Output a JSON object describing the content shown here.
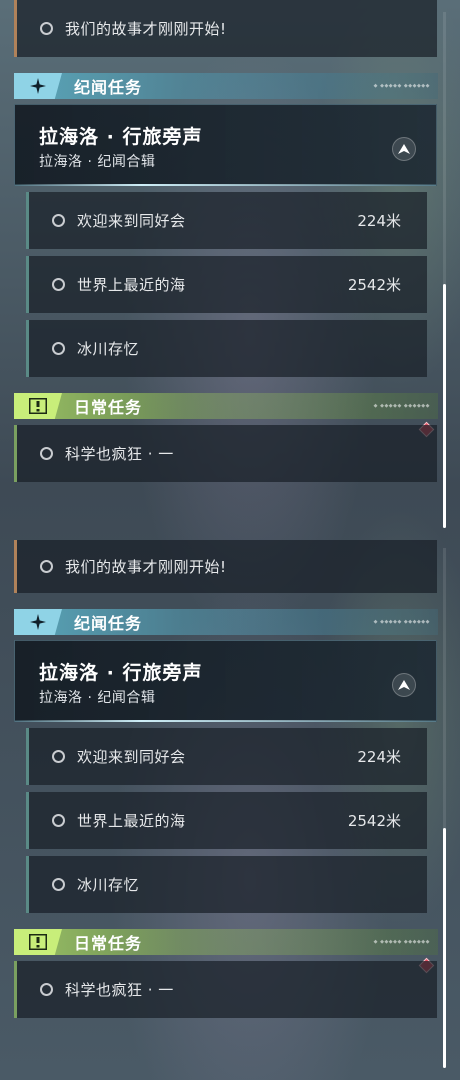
{
  "colors": {
    "explore_accent": "#8fd3e6",
    "daily_accent": "#c8ee7a",
    "notify": "#e04b5d"
  },
  "panels": [
    {
      "story_task": {
        "label": "我们的故事才刚刚开始!"
      },
      "explore_header": {
        "title": "纪闻任务",
        "icon": "sparkle-icon"
      },
      "quest": {
        "title": "拉海洛 · 行旅旁声",
        "subtitle": "拉海洛 · 纪闻合辑",
        "button_icon": "navigate-arrow-icon"
      },
      "tasks": [
        {
          "label": "欢迎来到同好会",
          "distance": "224米"
        },
        {
          "label": "世界上最近的海",
          "distance": "2542米"
        },
        {
          "label": "冰川存忆",
          "distance": ""
        }
      ],
      "daily_header": {
        "title": "日常任务",
        "icon": "alert-icon"
      },
      "daily_task": {
        "label": "科学也疯狂 · 一"
      }
    },
    {
      "story_task": {
        "label": "我们的故事才刚刚开始!"
      },
      "explore_header": {
        "title": "纪闻任务",
        "icon": "sparkle-icon"
      },
      "quest": {
        "title": "拉海洛 · 行旅旁声",
        "subtitle": "拉海洛 · 纪闻合辑",
        "button_icon": "navigate-arrow-icon"
      },
      "tasks": [
        {
          "label": "欢迎来到同好会",
          "distance": "224米"
        },
        {
          "label": "世界上最近的海",
          "distance": "2542米"
        },
        {
          "label": "冰川存忆",
          "distance": ""
        }
      ],
      "daily_header": {
        "title": "日常任务",
        "icon": "alert-icon"
      },
      "daily_task": {
        "label": "科学也疯狂 · 一"
      }
    }
  ]
}
